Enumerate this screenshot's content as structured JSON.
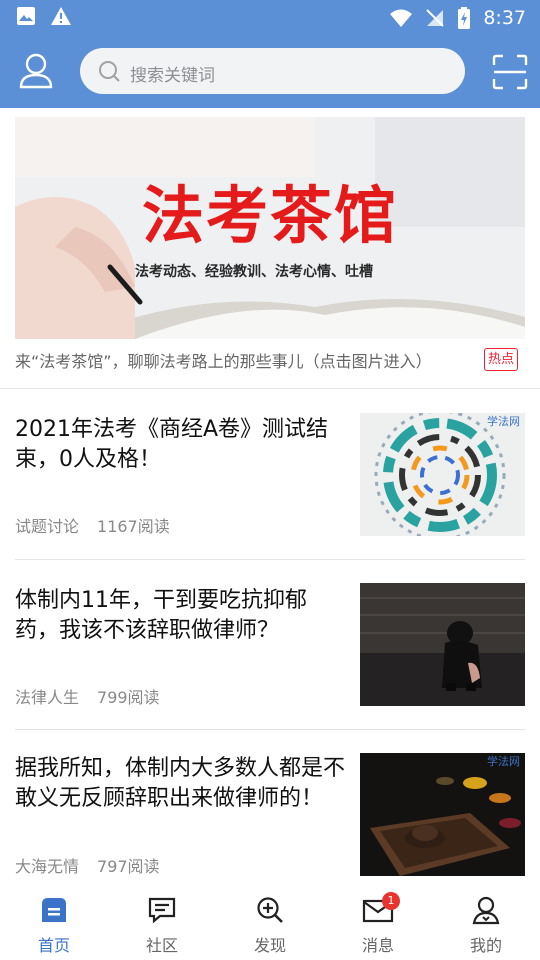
{
  "status_bar": {
    "time": "8:37"
  },
  "search": {
    "placeholder": "搜索关键词"
  },
  "banner": {
    "title": "法考茶馆",
    "subtitle": "法考动态、经验教训、法考心情、吐槽",
    "caption": "来“法考茶馆”，聊聊法考路上的那些事儿（点击图片进入）",
    "badge": "热点"
  },
  "articles": [
    {
      "title": "2021年法考《商经A卷》测试结束，0人及格！",
      "category": "试题讨论",
      "reads": "1167阅读",
      "watermark": "学法网"
    },
    {
      "title": "体制内11年，干到要吃抗抑郁药，我该不该辞职做律师？",
      "category": "法律人生",
      "reads": "799阅读"
    },
    {
      "title": "据我所知，体制内大多数人都是不敢义无反顾辞职出来做律师的！",
      "category": "大海无情",
      "reads": "797阅读",
      "watermark": "学法网"
    }
  ],
  "tabs": [
    {
      "label": "首页",
      "icon": "home-icon",
      "active": true
    },
    {
      "label": "社区",
      "icon": "chat-icon"
    },
    {
      "label": "发现",
      "icon": "discover-icon"
    },
    {
      "label": "消息",
      "icon": "mail-icon",
      "badge": "1"
    },
    {
      "label": "我的",
      "icon": "profile-icon"
    }
  ],
  "colors": {
    "header": "#5b8fd6",
    "accent": "#3a73c8",
    "hot": "#e23333",
    "badge": "#e8342f"
  }
}
